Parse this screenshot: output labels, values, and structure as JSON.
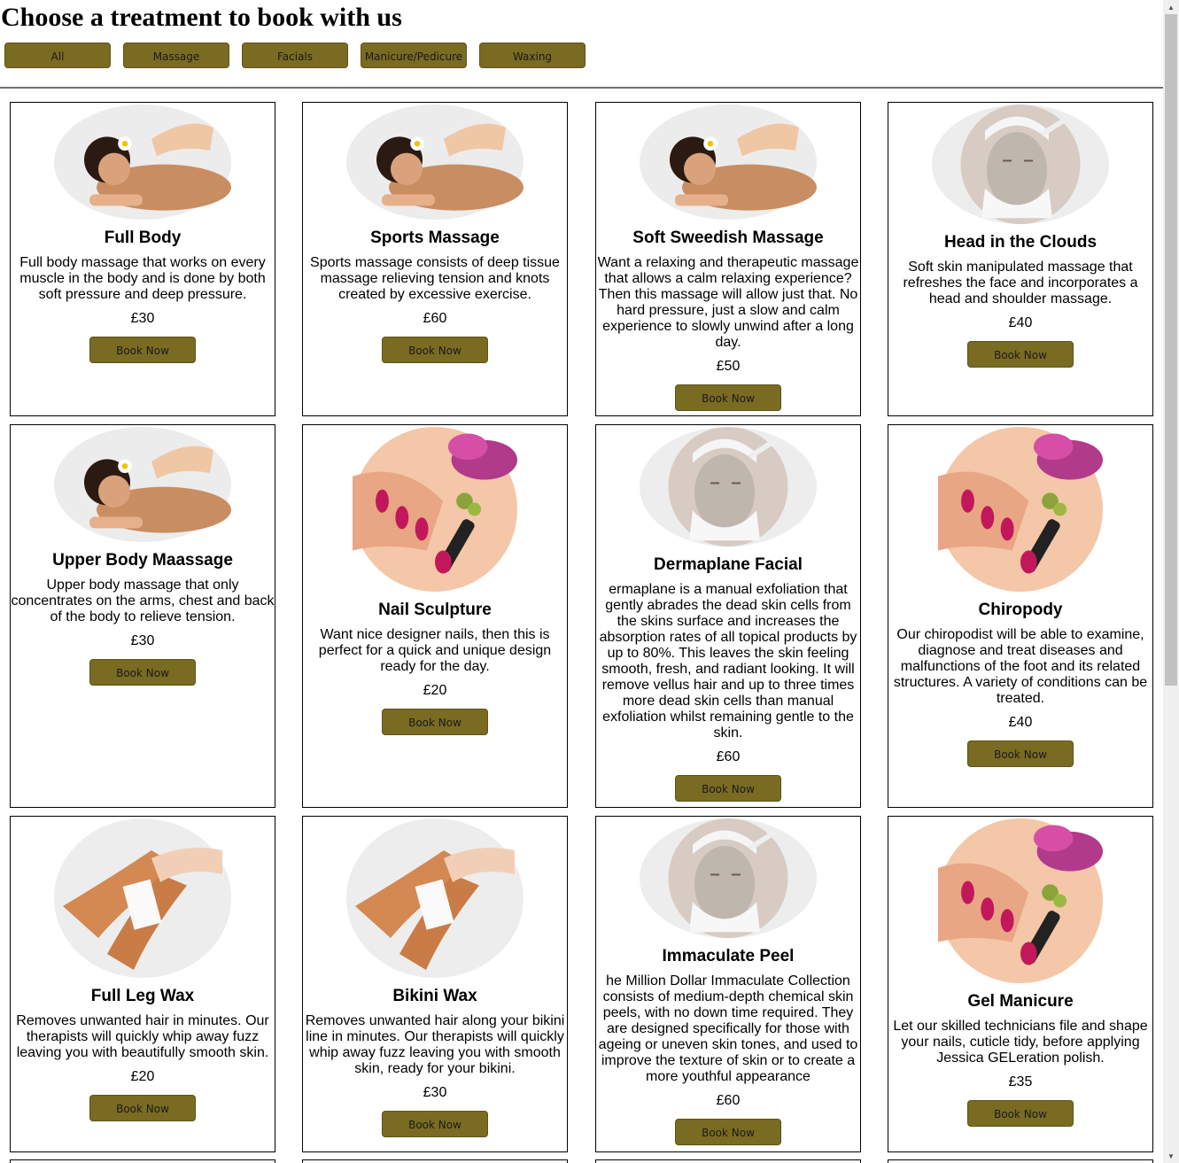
{
  "page": {
    "title": "Choose a treatment to book with us"
  },
  "filters": [
    {
      "label": "All"
    },
    {
      "label": "Massage"
    },
    {
      "label": "Facials"
    },
    {
      "label": "Manicure/Pedicure"
    },
    {
      "label": "Waxing"
    }
  ],
  "cards": [
    {
      "image": "massage",
      "title": "Full Body",
      "description": "Full body massage that works on every muscle in the body and is done by both soft pressure and deep pressure.",
      "price": "£30",
      "button": "Book Now"
    },
    {
      "image": "massage",
      "title": "Sports Massage",
      "description": "Sports massage consists of deep tissue massage relieving tension and knots created by excessive exercise.",
      "price": "£60",
      "button": "Book Now"
    },
    {
      "image": "massage",
      "title": "Soft Sweedish Massage",
      "description": "Want a relaxing and therapeutic massage that allows a calm relaxing experience? Then this massage will allow just that. No hard pressure, just a slow and calm experience to slowly unwind after a long day.",
      "price": "£50",
      "button": "Book Now"
    },
    {
      "image": "facial",
      "title": "Head in the Clouds",
      "description": "Soft skin manipulated massage that refreshes the face and incorporates a head and shoulder massage.",
      "price": "£40",
      "button": "Book Now"
    },
    {
      "image": "massage",
      "title": "Upper Body Maassage",
      "description": "Upper body massage that only concentrates on the arms, chest and back of the body to relieve tension.",
      "price": "£30",
      "button": "Book Now"
    },
    {
      "image": "nails",
      "title": "Nail Sculpture",
      "description": "Want nice designer nails, then this is perfect for a quick and unique design ready for the day.",
      "price": "£20",
      "button": "Book Now"
    },
    {
      "image": "facial",
      "title": "Dermaplane Facial",
      "description": "ermaplane is a manual exfoliation that gently abrades the dead skin cells from the skins surface and increases the absorption rates of all topical products by up to 80%. This leaves the skin feeling smooth, fresh, and radiant looking. It will remove vellus hair and up to three times more dead skin cells than manual exfoliation whilst remaining gentle to the skin.",
      "price": "£60",
      "button": "Book Now"
    },
    {
      "image": "nails",
      "title": "Chiropody",
      "description": "Our chiropodist will be able to examine, diagnose and treat diseases and malfunctions of the foot and its related structures. A variety of conditions can be treated.",
      "price": "£40",
      "button": "Book Now"
    },
    {
      "image": "legs",
      "title": "Full Leg Wax",
      "description": "Removes unwanted hair in minutes. Our therapists will quickly whip away fuzz leaving you with beautifully smooth skin.",
      "price": "£20",
      "button": "Book Now"
    },
    {
      "image": "legs",
      "title": "Bikini Wax",
      "description": "Removes unwanted hair along your bikini line in minutes. Our therapists will quickly whip away fuzz leaving you with smooth skin, ready for your bikini.",
      "price": "£30",
      "button": "Book Now"
    },
    {
      "image": "facial",
      "title": "Immaculate Peel",
      "description": "he Million Dollar Immaculate Collection consists of medium-depth chemical skin peels, with no down time required. They are designed specifically for those with ageing or uneven skin tones, and used to improve the texture of skin or to create a more youthful appearance",
      "price": "£60",
      "button": "Book Now"
    },
    {
      "image": "nails",
      "title": "Gel Manicure",
      "description": "Let our skilled technicians file and shape your nails, cuticle tidy, before applying Jessica GELeration polish.",
      "price": "£35",
      "button": "Book Now"
    }
  ],
  "colors": {
    "button_bg": "#7a6b22",
    "card_border": "#000000",
    "divider": "#6e6e6e"
  }
}
